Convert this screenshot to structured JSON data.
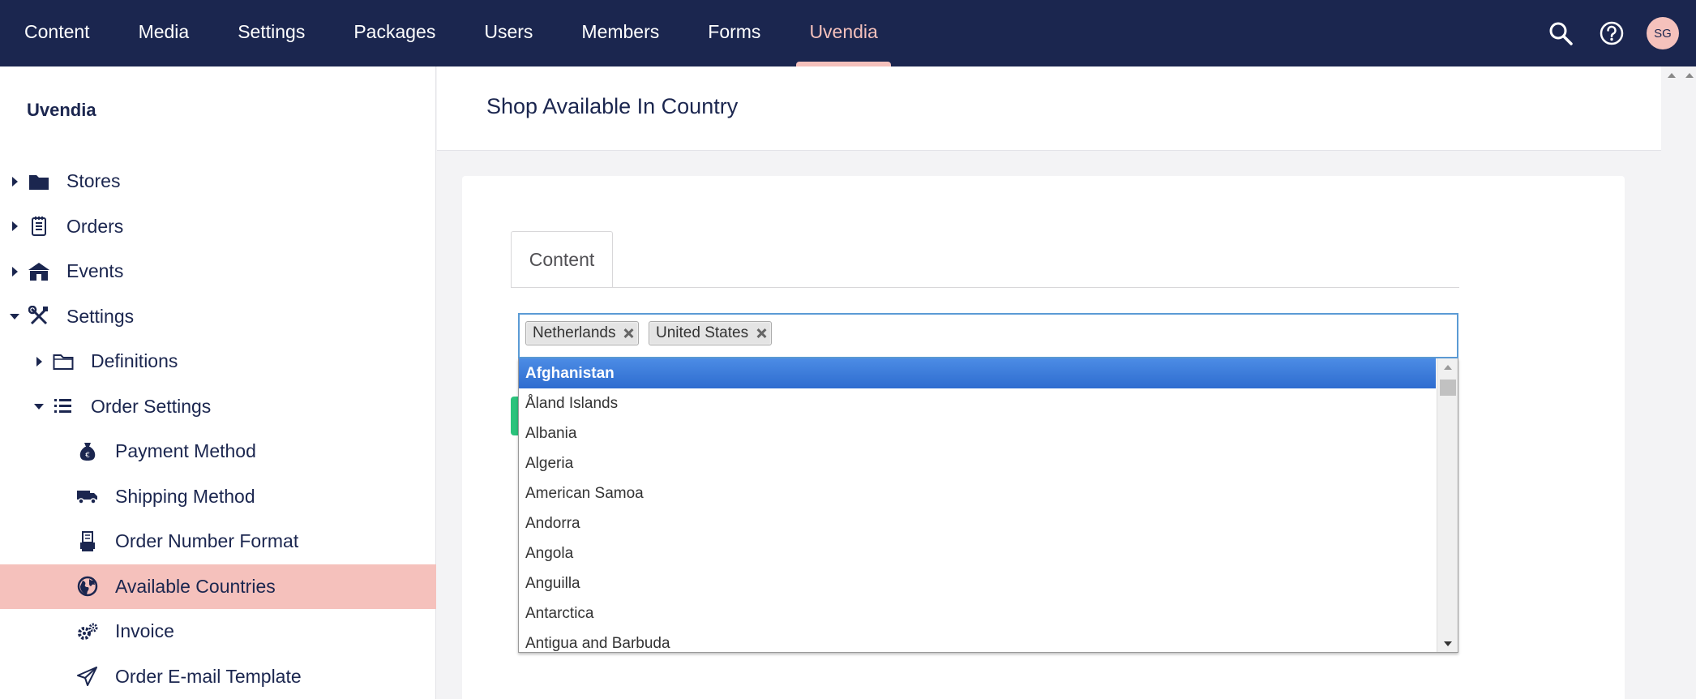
{
  "nav": {
    "items": [
      "Content",
      "Media",
      "Settings",
      "Packages",
      "Users",
      "Members",
      "Forms",
      "Uvendia"
    ],
    "active": "Uvendia",
    "avatar_initials": "SG"
  },
  "sidebar": {
    "title": "Uvendia",
    "items": [
      {
        "label": "Stores",
        "icon": "folder-icon",
        "caret": "right"
      },
      {
        "label": "Orders",
        "icon": "receipt-icon",
        "caret": "right"
      },
      {
        "label": "Events",
        "icon": "store-icon",
        "caret": "right"
      },
      {
        "label": "Settings",
        "icon": "tools-icon",
        "caret": "down"
      },
      {
        "label": "Definitions",
        "icon": "folder-outline-icon",
        "caret": "right"
      },
      {
        "label": "Order Settings",
        "icon": "list-icon",
        "caret": "down"
      },
      {
        "label": "Payment Method",
        "icon": "money-bag-icon"
      },
      {
        "label": "Shipping Method",
        "icon": "truck-icon"
      },
      {
        "label": "Order Number Format",
        "icon": "printer-icon"
      },
      {
        "label": "Available Countries",
        "icon": "globe-icon",
        "selected": true
      },
      {
        "label": "Invoice",
        "icon": "gears-icon"
      },
      {
        "label": "Order E-mail Template",
        "icon": "paper-plane-icon"
      }
    ]
  },
  "header": {
    "title": "Shop Available In Country"
  },
  "editor": {
    "tab_label": "Content",
    "selected_countries": [
      "Netherlands",
      "United States"
    ],
    "options": [
      "Afghanistan",
      "Åland Islands",
      "Albania",
      "Algeria",
      "American Samoa",
      "Andorra",
      "Angola",
      "Anguilla",
      "Antarctica",
      "Antigua and Barbuda"
    ],
    "highlighted_option": "Afghanistan"
  },
  "colors": {
    "navbar": "#1b264f",
    "accent": "#f5c1bc",
    "highlight": "#3875d7",
    "green": "#2bc37c"
  }
}
